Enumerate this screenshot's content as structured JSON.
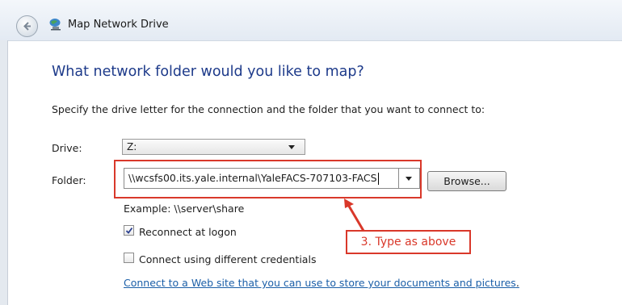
{
  "window": {
    "title": "Map Network Drive"
  },
  "page": {
    "heading": "What network folder would you like to map?",
    "instructions": "Specify the drive letter for the connection and the folder that you want to connect to:"
  },
  "drive": {
    "label": "Drive:",
    "value": "Z:"
  },
  "folder": {
    "label": "Folder:",
    "value": "\\\\wcsfs00.its.yale.internal\\YaleFACS-707103-FACS",
    "example": "Example: \\\\server\\share"
  },
  "browse_label": "Browse...",
  "options": {
    "reconnect": {
      "label": "Reconnect at logon",
      "checked": true
    },
    "different_credentials": {
      "label": "Connect using different credentials",
      "checked": false
    }
  },
  "link_text": "Connect to a Web site that you can use to store your documents and pictures",
  "link_trailing": ".",
  "annotation": {
    "text": "3. Type as above",
    "color": "#d9382a"
  },
  "colors": {
    "heading": "#1d3a8a",
    "link": "#1b5fa8"
  },
  "icons": {
    "back": "back-arrow-icon",
    "app": "network-drive-icon",
    "dropdown": "chevron-down-icon",
    "check": "checkmark-icon"
  }
}
